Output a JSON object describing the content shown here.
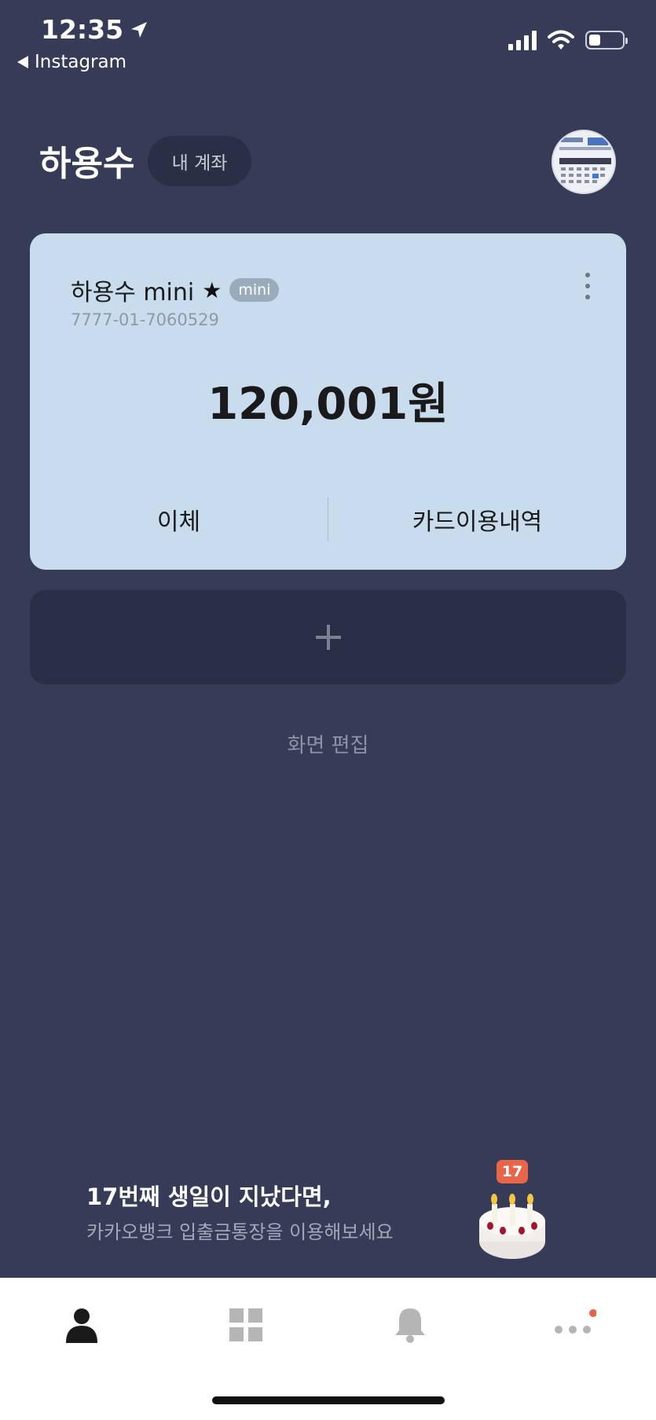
{
  "status_bar": {
    "time": "12:35",
    "back_app": "Instagram"
  },
  "header": {
    "user_name": "하용수",
    "my_account_label": "내 계좌"
  },
  "account_card": {
    "name": "하용수 mini",
    "badge": "mini",
    "account_number": "7777-01-7060529",
    "balance": "120,001원",
    "actions": [
      "이체",
      "카드이용내역"
    ],
    "background_color": "#c8dced"
  },
  "add_account": {
    "icon": "plus-icon"
  },
  "edit_screen_label": "화면 편집",
  "promo": {
    "title": "17번째 생일이 지났다면,",
    "subtitle": "카카오뱅크 입출금통장을 이용해보세요",
    "badge": "17"
  },
  "tab_bar": {
    "tabs": [
      "person-icon",
      "grid-icon",
      "bell-icon",
      "more-icon"
    ],
    "notification_dot_color": "#e8654a"
  },
  "colors": {
    "background": "#363c57",
    "card_dark": "#2b2f45"
  }
}
